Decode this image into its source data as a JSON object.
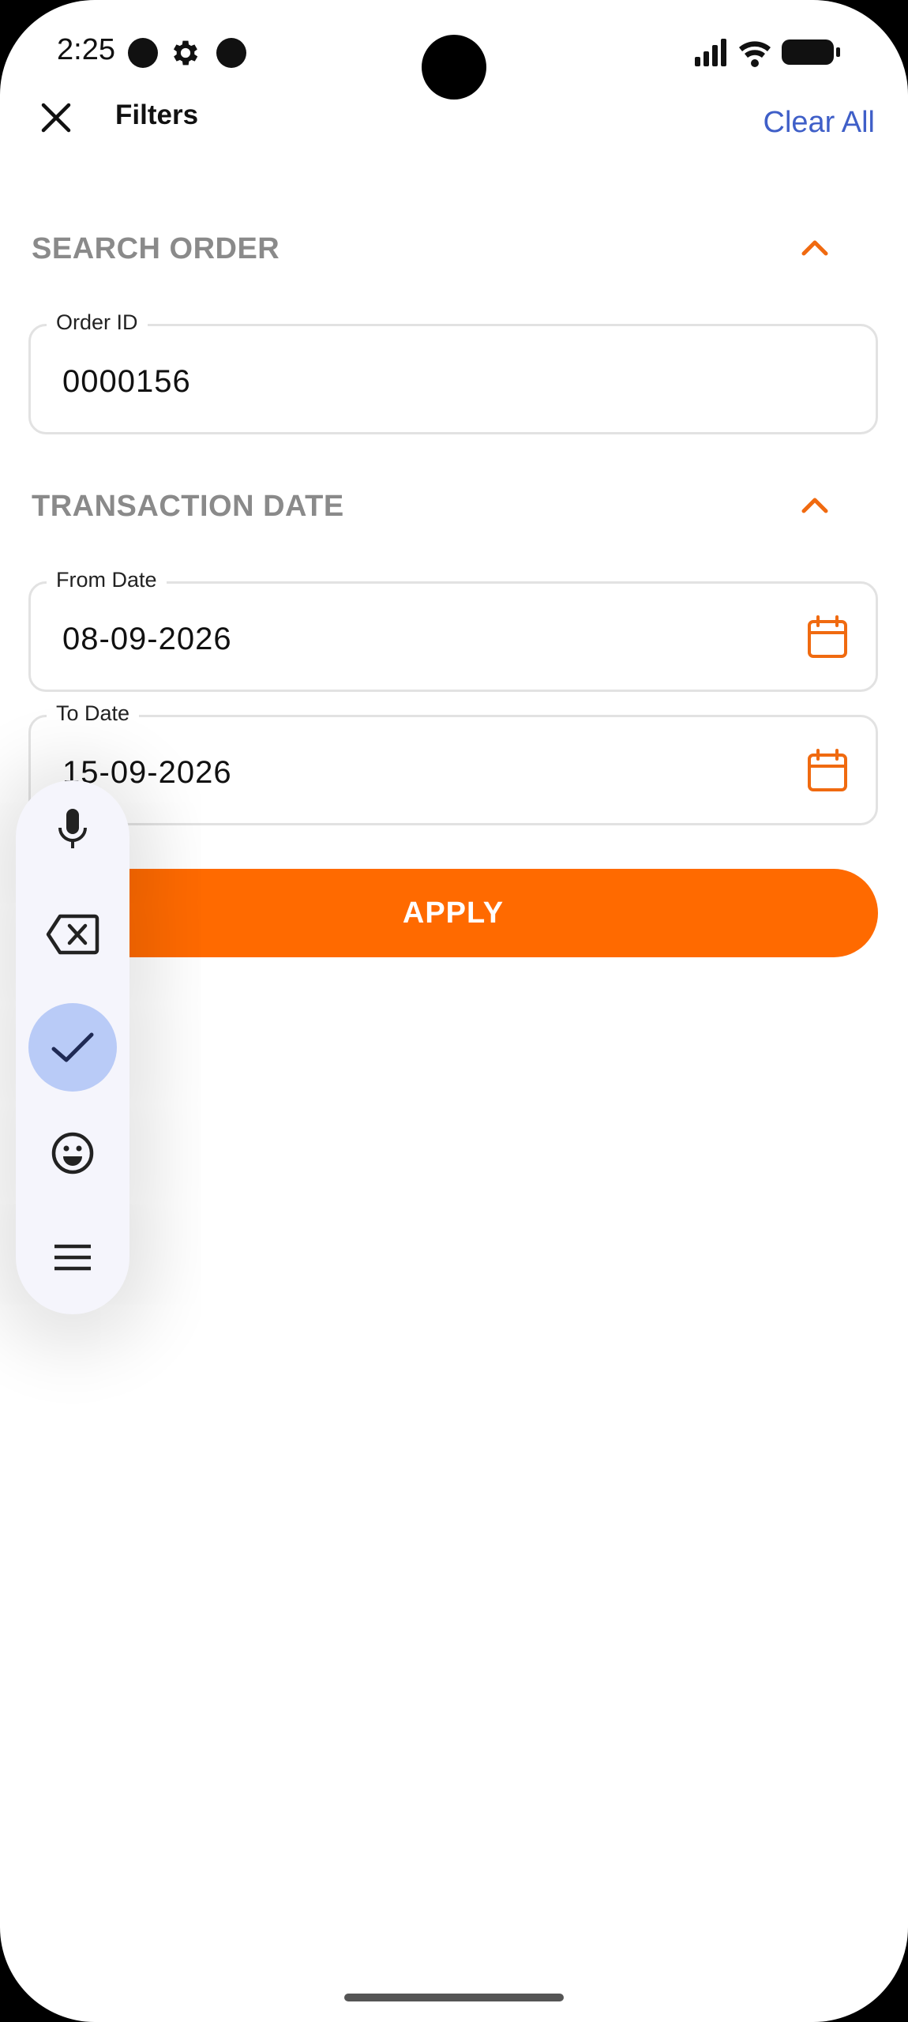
{
  "status_bar": {
    "time": "2:25",
    "icons": [
      "notification-dot-icon",
      "settings-gear-icon",
      "notification-dot-icon",
      "signal-icon",
      "wifi-icon",
      "battery-icon"
    ]
  },
  "header": {
    "title": "Filters",
    "clear_label": "Clear All",
    "close_icon": "close-icon"
  },
  "search_order": {
    "title": "SEARCH ORDER",
    "order_id": {
      "label": "Order ID",
      "value": "0000156"
    }
  },
  "transaction_date": {
    "title": "TRANSACTION DATE",
    "from_date": {
      "label": "From Date",
      "value": "08-09-2026"
    },
    "to_date": {
      "label": "To Date",
      "value": "15-09-2026"
    }
  },
  "apply_label": "APPLY",
  "floating_toolbar": {
    "items": [
      "microphone-icon",
      "backspace-icon",
      "check-icon",
      "emoji-icon",
      "menu-icon"
    ],
    "active_item": "check-icon"
  },
  "colors": {
    "accent": "#ff6a00",
    "link": "#3f5fc8",
    "section_title": "#8a8a8a",
    "active_toolbar": "#b9cbf7"
  }
}
